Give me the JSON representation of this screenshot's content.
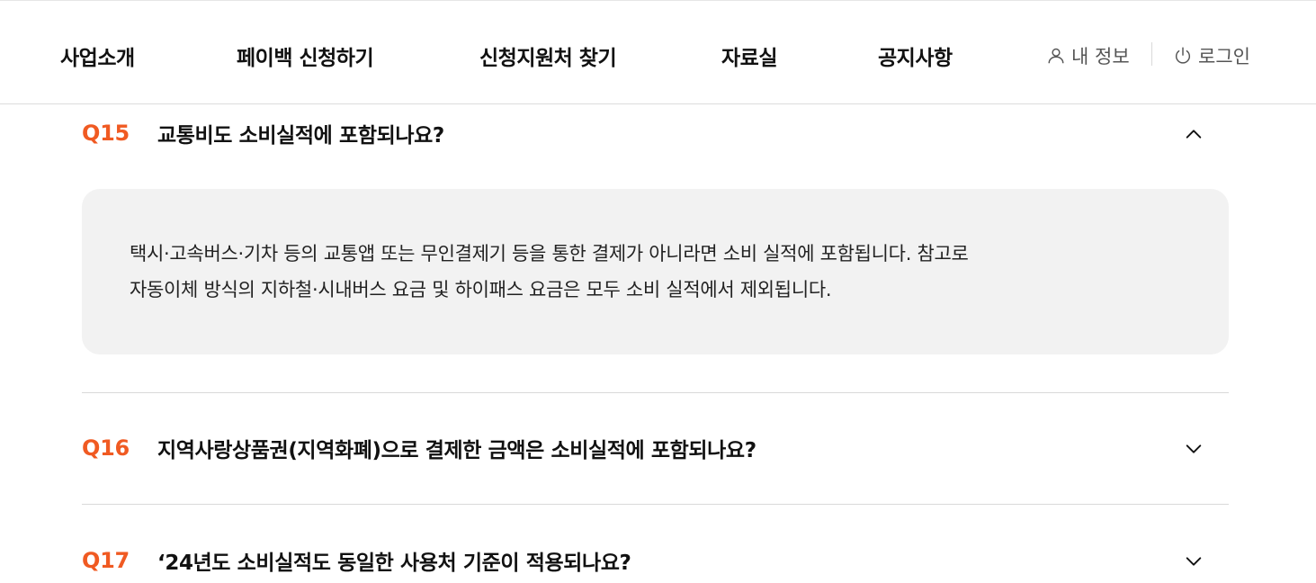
{
  "nav": {
    "items": [
      "사업소개",
      "페이백 신청하기",
      "신청지원처 찾기",
      "자료실",
      "공지사항"
    ],
    "my_info": "내 정보",
    "login": "로그인"
  },
  "faq": [
    {
      "num": "Q15",
      "question": "교통비도 소비실적에 포함되나요?",
      "expanded": true,
      "answer_lines": [
        "택시·고속버스·기차 등의 교통앱 또는 무인결제기 등을 통한 결제가 아니라면 소비 실적에 포함됩니다. 참고로",
        "자동이체 방식의 지하철·시내버스 요금 및 하이패스 요금은 모두 소비 실적에서 제외됩니다."
      ]
    },
    {
      "num": "Q16",
      "question": "지역사랑상품권(지역화폐)으로 결제한 금액은 소비실적에 포함되나요?",
      "expanded": false
    },
    {
      "num": "Q17",
      "question": "‘24년도 소비실적도 동일한 사용처 기준이 적용되나요?",
      "expanded": false
    }
  ],
  "colors": {
    "accent": "#f05a22",
    "answer_bg": "#f2f2f2",
    "divider": "#d9d9d9"
  },
  "icons": {
    "my_info": "user-icon",
    "login": "power-icon",
    "expanded": "chevron-up-icon",
    "collapsed": "chevron-down-icon"
  }
}
